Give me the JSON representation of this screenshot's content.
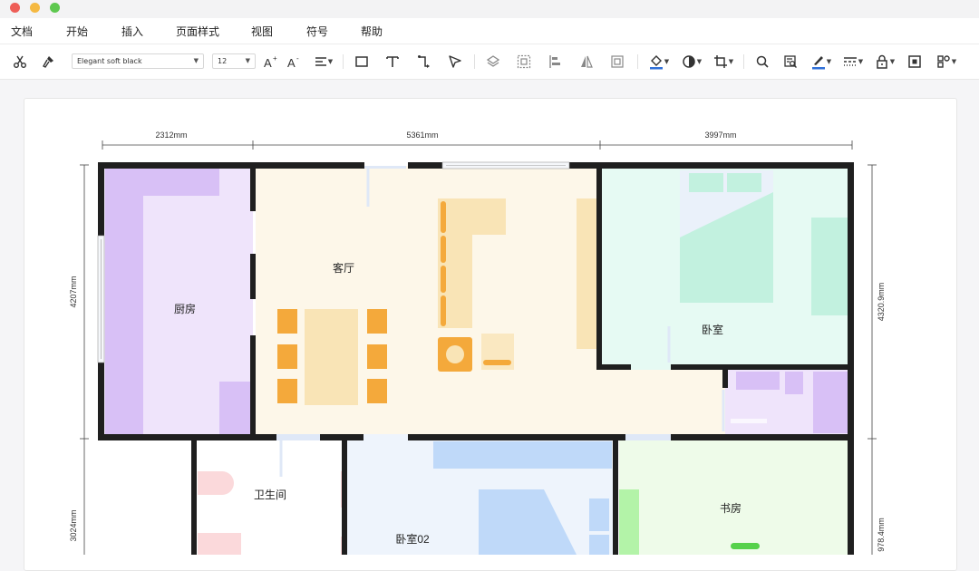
{
  "window": {
    "traffic_lights": [
      {
        "name": "close-light",
        "color": "#ee5e57"
      },
      {
        "name": "minimize-light",
        "color": "#f5b942"
      },
      {
        "name": "zoom-light",
        "color": "#5ec84f"
      }
    ]
  },
  "menu": {
    "items": [
      {
        "id": "doc",
        "label": "文档"
      },
      {
        "id": "start",
        "label": "开始"
      },
      {
        "id": "insert",
        "label": "插入"
      },
      {
        "id": "page-style",
        "label": "页面样式"
      },
      {
        "id": "view",
        "label": "视图"
      },
      {
        "id": "symbol",
        "label": "符号"
      },
      {
        "id": "help",
        "label": "帮助"
      }
    ]
  },
  "toolbar": {
    "font_family": "Elegant soft black",
    "font_size": "12",
    "icons": [
      "cut-icon",
      "format-painter-icon",
      "increase-font-icon",
      "decrease-font-icon",
      "align-icon",
      "rectangle-icon",
      "text-icon",
      "connector-icon",
      "pointer-icon",
      "layers-icon",
      "group-icon",
      "align-left-icon",
      "flip-icon",
      "frame-icon",
      "fill-color-icon",
      "shape-style-icon",
      "crop-icon",
      "search-icon",
      "find-replace-icon",
      "line-color-icon",
      "line-style-icon",
      "lock-icon",
      "fit-icon",
      "more-icon"
    ],
    "accent_color": "#2f6fd8"
  },
  "floorplan": {
    "dimensions": {
      "top": [
        "2312mm",
        "5361mm",
        "3997mm"
      ],
      "left": [
        "4207mm",
        "3024mm"
      ],
      "right": [
        "4320.9mm",
        "978.4mm"
      ]
    },
    "rooms": {
      "kitchen": "厨房",
      "living": "客厅",
      "bedroom": "卧室",
      "bathroom": "卫生间",
      "bedroom02": "卧室02",
      "study": "书房"
    },
    "colors": {
      "wall": "#1f1f1f",
      "kitchen": "#efe4fb",
      "kitchen_dark": "#d8c0f6",
      "living": "#fdf7e9",
      "furniture_orange": "#f4a93b",
      "furniture_light": "#f9e4b6",
      "bedroom": "#e6faf3",
      "bed": "#c2f1df",
      "bath": "#ffffff",
      "bath_fixture": "#fbd9db",
      "bedroom02": "#eef4fc",
      "bed02": "#bfd9f9",
      "study": "#eefbe9",
      "study_green": "#b3f3a8",
      "study_accent": "#56d14b"
    }
  }
}
